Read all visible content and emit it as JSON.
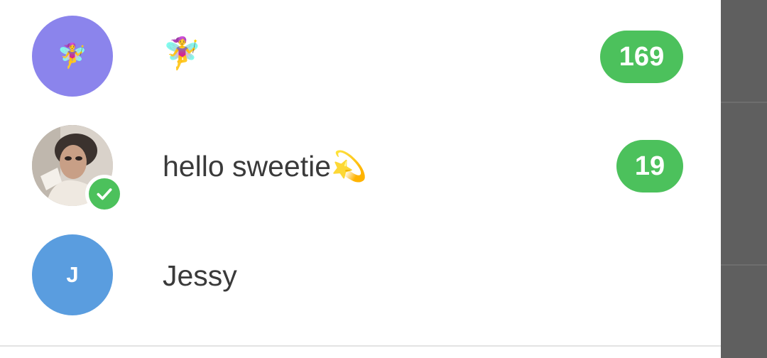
{
  "chats": [
    {
      "title": "🧚‍♀️",
      "avatar": {
        "type": "emoji",
        "content": "🧚‍♀️",
        "color": "#8b84ec"
      },
      "unread": "169"
    },
    {
      "title": "hello sweetie💫",
      "avatar": {
        "type": "photo",
        "verified": true
      },
      "unread": "19"
    },
    {
      "title": "Jessy",
      "avatar": {
        "type": "letter",
        "content": "J",
        "color": "#5a9ddf"
      },
      "unread": ""
    }
  ],
  "colors": {
    "badge": "#4cc15c",
    "text": "#3a3a3a",
    "scrim": "#5f5f5f"
  }
}
